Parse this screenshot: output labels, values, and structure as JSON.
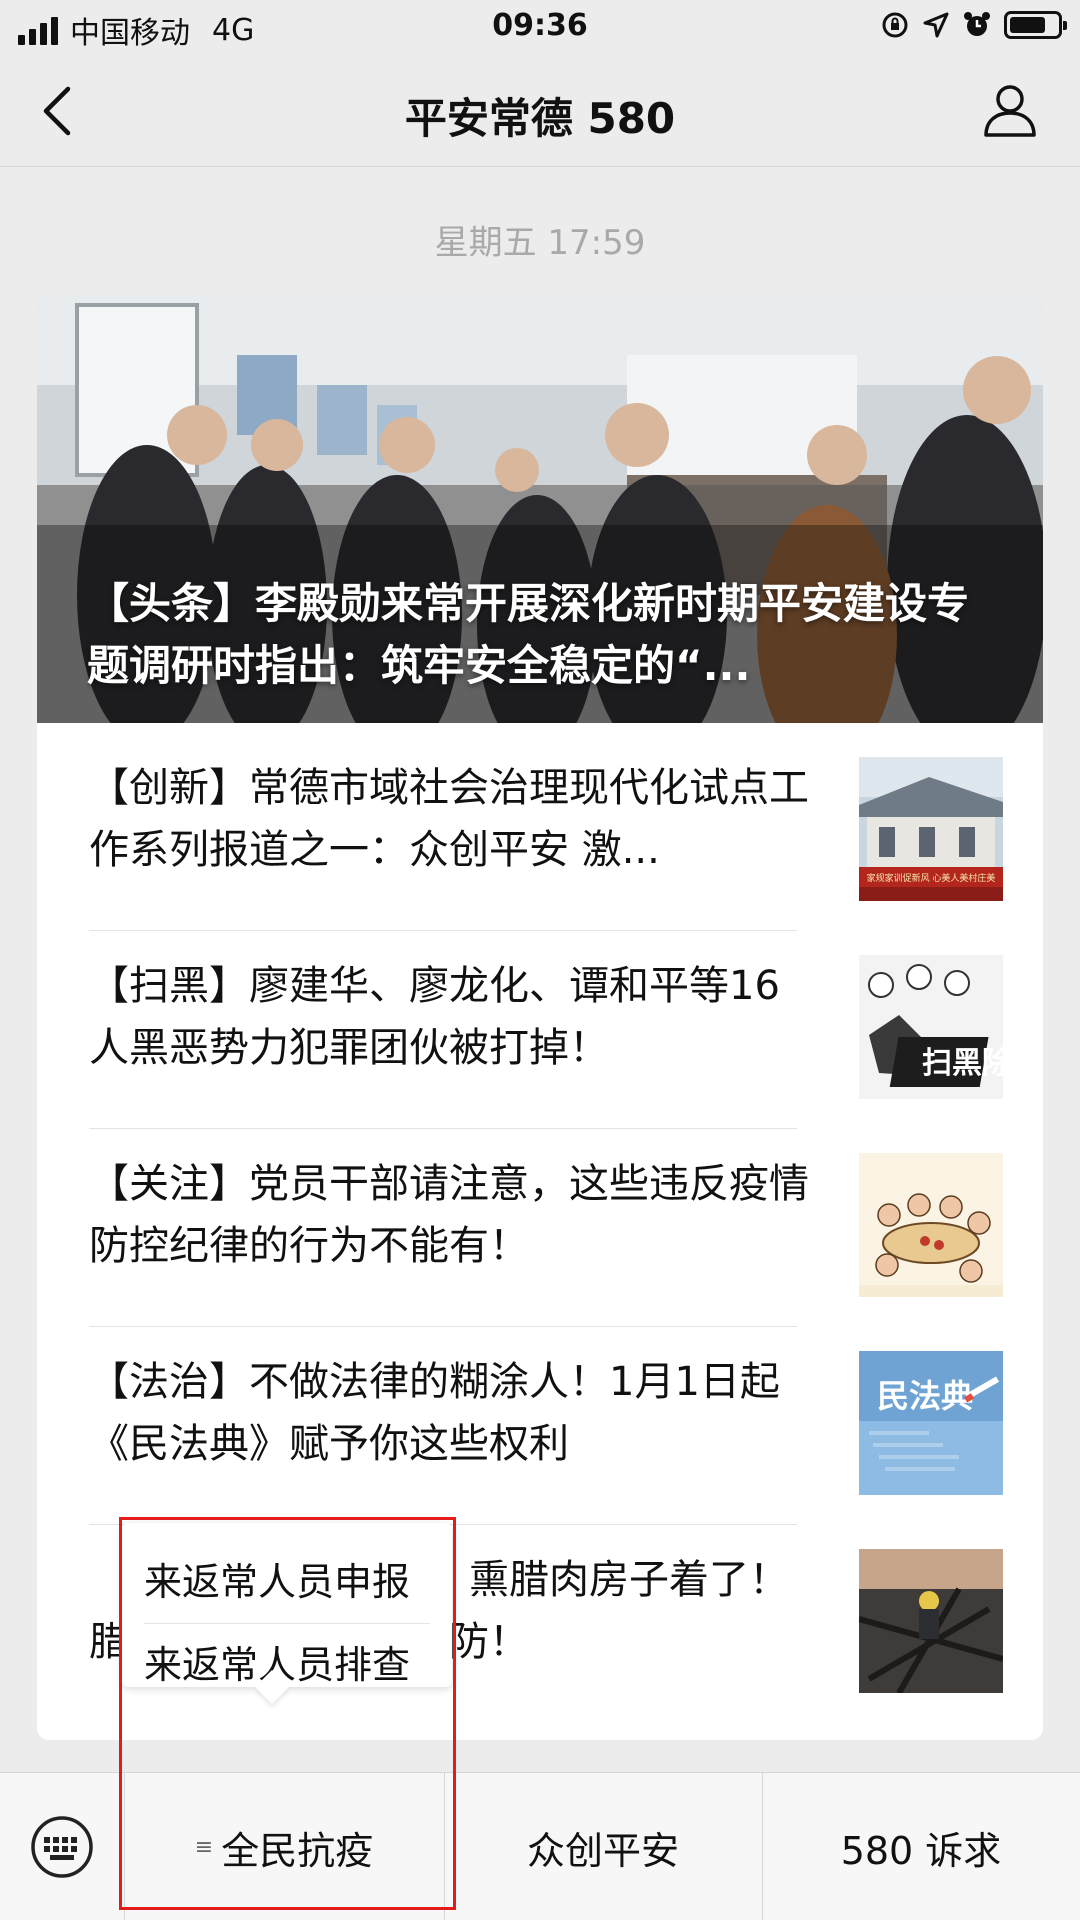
{
  "status_bar": {
    "carrier": "中国移动",
    "network": "4G",
    "time": "09:36",
    "battery_level": 0.75
  },
  "nav": {
    "title": "平安常德 580"
  },
  "timestamp": "星期五 17:59",
  "headline": {
    "title": "【头条】李殿勋来常开展深化新时期平安建设专题调研时指出：筑牢安全稳定的“..."
  },
  "articles": [
    {
      "title": "【创新】常德市域社会治理现代化试点工作系列报道之一：众创平安 激...",
      "thumb_caption": "家规家训促新风 心美人美村庄美"
    },
    {
      "title": "【扫黑】廖建华、廖龙化、谭和平等16人黑恶势力犯罪团伙被打掉！",
      "thumb_caption": "扫黑除"
    },
    {
      "title": "【关注】党员干部请注意，这些违反疫情防控纪律的行为不能有！",
      "thumb_caption": ""
    },
    {
      "title": "【法治】不做法律的糊涂人！1月1日起《民法典》赋予你这些权利",
      "thumb_caption": "民法典"
    },
    {
      "title_visible_end_line1": "熏腊肉房子着了！",
      "title_visible_line2_start": "腊",
      "title_visible_line2_end": "要防！"
    }
  ],
  "popup_menu": {
    "items": [
      "来返常人员申报",
      "来返常人员排查"
    ]
  },
  "bottom_menu": {
    "items": [
      {
        "label": "全民抗疫",
        "has_submenu": true
      },
      {
        "label": "众创平安",
        "has_submenu": false
      },
      {
        "label": "580 诉求",
        "has_submenu": false
      }
    ]
  },
  "colors": {
    "highlight_box": "#e41b1b",
    "background": "#ececec",
    "timestamp": "#a9a9a9"
  }
}
